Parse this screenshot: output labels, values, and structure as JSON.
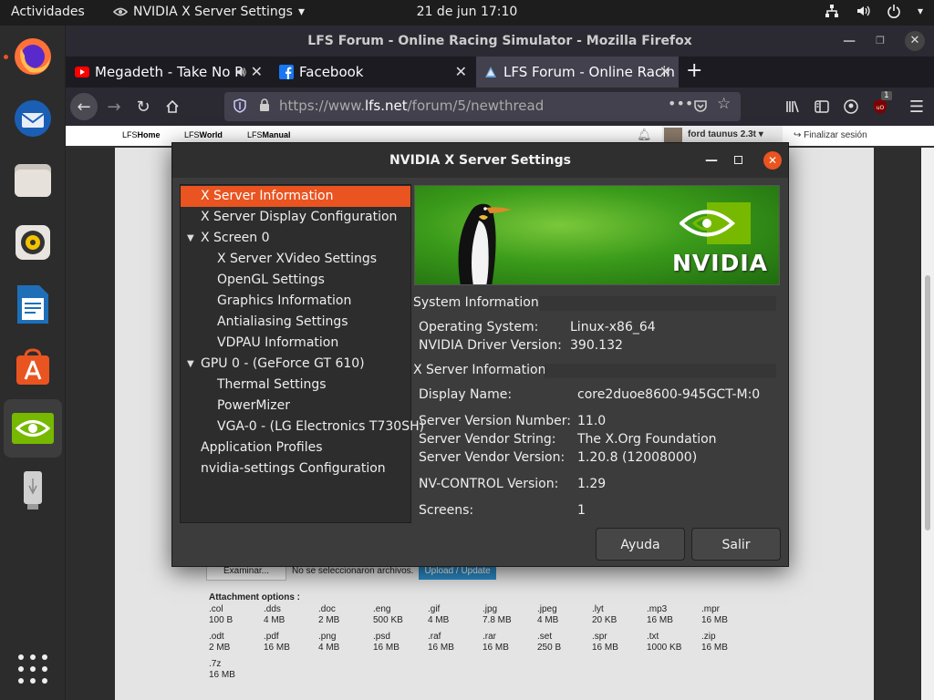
{
  "topbar": {
    "activities": "Actividades",
    "app_name": "NVIDIA X Server Settings",
    "clock": "21 de jun  17:10"
  },
  "dock": {
    "items": [
      "firefox-icon",
      "thunderbird-icon",
      "files-icon",
      "rhythmbox-icon",
      "writer-icon",
      "software-icon",
      "nvidia-icon",
      "usb-icon"
    ],
    "accent": "#e95420"
  },
  "firefox": {
    "title": "LFS Forum - Online Racing Simulator - Mozilla Firefox",
    "tabs": [
      {
        "label": "Megadeth - Take No P"
      },
      {
        "label": "Facebook"
      },
      {
        "label": "LFS Forum - Online Racin"
      }
    ],
    "url_prefix": "https://www.",
    "url_domain": "lfs.net",
    "url_path": "/forum/5/newthread",
    "ublock_badge": "1"
  },
  "lfs": {
    "nav": [
      {
        "prefix": "LFS",
        "name": "Home"
      },
      {
        "prefix": "LFS",
        "name": "World"
      },
      {
        "prefix": "LFS",
        "name": "Manual"
      }
    ],
    "user": "ford taunus 2.3t",
    "logout": "Finalizar sesión",
    "browse_label": "Examinar...",
    "no_file": "No se seleccionaron archivos.",
    "upload_label": "Upload / Update",
    "attachment_heading": "Attachment options :",
    "attachments": [
      {
        "ext": ".col",
        "size": "100 B"
      },
      {
        "ext": ".dds",
        "size": "4 MB"
      },
      {
        "ext": ".doc",
        "size": "2 MB"
      },
      {
        "ext": ".eng",
        "size": "500 KB"
      },
      {
        "ext": ".gif",
        "size": "4 MB"
      },
      {
        "ext": ".jpg",
        "size": "7.8 MB"
      },
      {
        "ext": ".jpeg",
        "size": "4 MB"
      },
      {
        "ext": ".lyt",
        "size": "20 KB"
      },
      {
        "ext": ".mp3",
        "size": "16 MB"
      },
      {
        "ext": ".mpr",
        "size": "16 MB"
      },
      {
        "ext": ".odt",
        "size": "2 MB"
      },
      {
        "ext": ".pdf",
        "size": "16 MB"
      },
      {
        "ext": ".png",
        "size": "4 MB"
      },
      {
        "ext": ".psd",
        "size": "16 MB"
      },
      {
        "ext": ".raf",
        "size": "16 MB"
      },
      {
        "ext": ".rar",
        "size": "16 MB"
      },
      {
        "ext": ".set",
        "size": "250 B"
      },
      {
        "ext": ".spr",
        "size": "16 MB"
      },
      {
        "ext": ".txt",
        "size": "1000 KB"
      },
      {
        "ext": ".zip",
        "size": "16 MB"
      },
      {
        "ext": ".7z",
        "size": "16 MB"
      }
    ]
  },
  "nvidia": {
    "title": "NVIDIA X Server Settings",
    "tree": [
      {
        "label": "X Server Information",
        "level": 0,
        "selected": true,
        "expander": false
      },
      {
        "label": "X Server Display Configuration",
        "level": 0,
        "selected": false,
        "expander": false
      },
      {
        "label": "X Screen 0",
        "level": 0,
        "selected": false,
        "expander": true
      },
      {
        "label": "X Server XVideo Settings",
        "level": 1,
        "selected": false,
        "expander": false
      },
      {
        "label": "OpenGL Settings",
        "level": 1,
        "selected": false,
        "expander": false
      },
      {
        "label": "Graphics Information",
        "level": 1,
        "selected": false,
        "expander": false
      },
      {
        "label": "Antialiasing Settings",
        "level": 1,
        "selected": false,
        "expander": false
      },
      {
        "label": "VDPAU Information",
        "level": 1,
        "selected": false,
        "expander": false
      },
      {
        "label": "GPU 0 - (GeForce GT 610)",
        "level": 0,
        "selected": false,
        "expander": true
      },
      {
        "label": "Thermal Settings",
        "level": 1,
        "selected": false,
        "expander": false
      },
      {
        "label": "PowerMizer",
        "level": 1,
        "selected": false,
        "expander": false
      },
      {
        "label": "VGA-0 - (LG Electronics T730SH)",
        "level": 1,
        "selected": false,
        "expander": false
      },
      {
        "label": "Application Profiles",
        "level": 0,
        "selected": false,
        "expander": false
      },
      {
        "label": "nvidia-settings Configuration",
        "level": 0,
        "selected": false,
        "expander": false
      }
    ],
    "banner_brand": "NVIDIA",
    "system_info": {
      "heading": "System Information",
      "rows": [
        {
          "key": "Operating System:",
          "value": "Linux-x86_64"
        },
        {
          "key": "NVIDIA Driver Version:",
          "value": "390.132"
        }
      ]
    },
    "xserver_info": {
      "heading": "X Server Information",
      "rows": [
        {
          "key": "Display Name:",
          "value": "core2duoe8600-945GCT-M:0"
        },
        {
          "key": "Server Version Number:",
          "value": "11.0"
        },
        {
          "key": "Server Vendor String:",
          "value": "The X.Org Foundation"
        },
        {
          "key": "Server Vendor Version:",
          "value": "1.20.8 (12008000)"
        },
        {
          "key": "NV-CONTROL Version:",
          "value": "1.29"
        },
        {
          "key": "Screens:",
          "value": "1"
        }
      ]
    },
    "help_label": "Ayuda",
    "quit_label": "Salir",
    "accent": "#e95420",
    "brand_green": "#76b900"
  }
}
